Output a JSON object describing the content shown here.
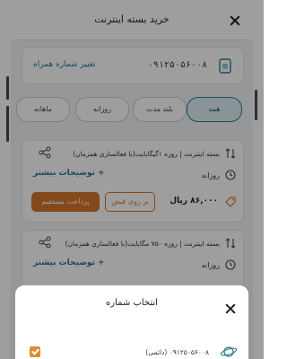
{
  "header": {
    "title": "خرید بسته اینترنت"
  },
  "sim": {
    "number": "۰۹۱۲۵۰۵۶۰۰۸",
    "change_label": "تغییر شماره همراه"
  },
  "tabs": [
    {
      "label": "همه",
      "active": true
    },
    {
      "label": "بلند مدت",
      "active": false
    },
    {
      "label": "روزانه",
      "active": false
    },
    {
      "label": "ماهانه",
      "active": false
    }
  ],
  "packages": [
    {
      "title": "بسته اینترنت | روزه ۱گیگابایت(با فعالسازی همزمان)",
      "duration": "روزانه",
      "details_label": "+ توضیحات بیشتر",
      "price": "۸۶,۰۰۰ ریال",
      "bill_label": "بر روی قبض",
      "pay_label": "پرداخت مستقیم"
    },
    {
      "title": "بسته اینترنت | روزه ۷۵۰ مگابایت(با فعالسازی همزمان)",
      "duration": "روزانه",
      "details_label": "+ توضیحات بیشتر"
    }
  ],
  "sheet": {
    "title": "انتخاب شماره",
    "row_number": "۰۹۱۲۵۰۵۶۰۰۸ (دائمی)"
  },
  "colors": {
    "accent": "#2c7a92",
    "orange": "#d6772a",
    "overlay": "rgba(0,0,0,0.38)"
  }
}
